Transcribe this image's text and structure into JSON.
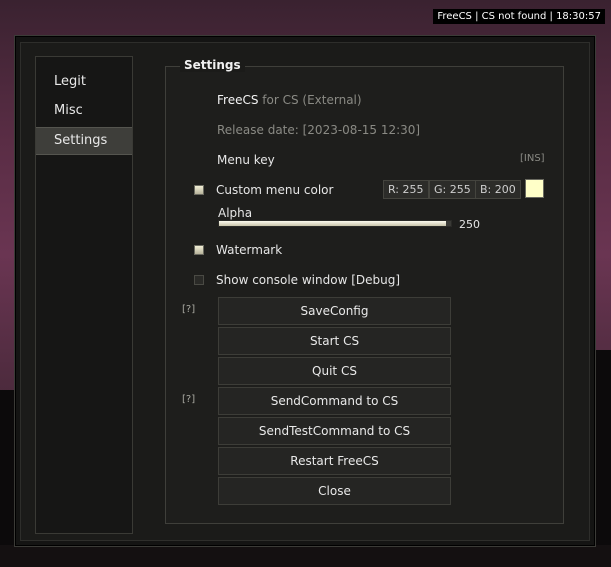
{
  "overlay": {
    "watermark": "FreeCS | CS not found | 18:30:57"
  },
  "sidebar": {
    "tabs": [
      {
        "label": "Legit",
        "active": false
      },
      {
        "label": "Misc",
        "active": false
      },
      {
        "label": "Settings",
        "active": true
      }
    ]
  },
  "settings": {
    "title": "Settings",
    "brand": "FreeCS",
    "brand_suffix": "for CS (External)",
    "release_date": "Release date: [2023-08-15 12:30]",
    "menu_key_label": "Menu key",
    "menu_key_value": "[INS]",
    "custom_color": {
      "label": "Custom menu color",
      "checked": true,
      "r": "R: 255",
      "g": "G: 255",
      "b": "B: 200",
      "swatch_color": "#FFFFC8"
    },
    "alpha": {
      "label": "Alpha",
      "value": "250",
      "fraction": 0.98
    },
    "watermark": {
      "label": "Watermark",
      "checked": true
    },
    "console": {
      "label": "Show console window [Debug]",
      "checked": false
    },
    "help_marker": "[?]",
    "buttons": {
      "save": "SaveConfig",
      "start": "Start CS",
      "quit": "Quit CS",
      "send": "SendCommand to CS",
      "send_test": "SendTestCommand to CS",
      "restart": "Restart FreeCS",
      "close": "Close"
    }
  }
}
